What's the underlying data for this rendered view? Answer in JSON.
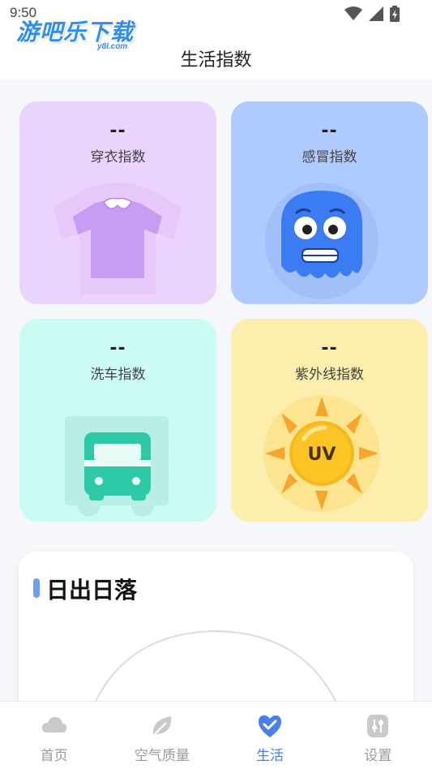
{
  "status_bar": {
    "time": "9:50"
  },
  "watermark": {
    "main": "游吧乐下载",
    "sub": "y8l.com"
  },
  "header": {
    "title": "生活指数"
  },
  "indices": [
    {
      "value": "--",
      "label": "穿衣指数",
      "color": "#ead3fc",
      "icon": "shirt-icon"
    },
    {
      "value": "--",
      "label": "感冒指数",
      "color": "#afcaff",
      "icon": "cold-face-icon"
    },
    {
      "value": "--",
      "label": "洗车指数",
      "color": "#ccfbf5",
      "icon": "car-icon"
    },
    {
      "value": "--",
      "label": "紫外线指数",
      "color": "#fdeeae",
      "icon": "uv-sun-icon"
    }
  ],
  "sunrise": {
    "title": "日出日落"
  },
  "tabs": [
    {
      "label": "首页",
      "icon": "cloud-icon",
      "active": false
    },
    {
      "label": "空气质量",
      "icon": "leaf-icon",
      "active": false
    },
    {
      "label": "生活",
      "icon": "heart-check-icon",
      "active": true
    },
    {
      "label": "设置",
      "icon": "settings-sliders-icon",
      "active": false
    }
  ],
  "colors": {
    "accent": "#4a7fea",
    "inactive": "#9a9a9a"
  }
}
